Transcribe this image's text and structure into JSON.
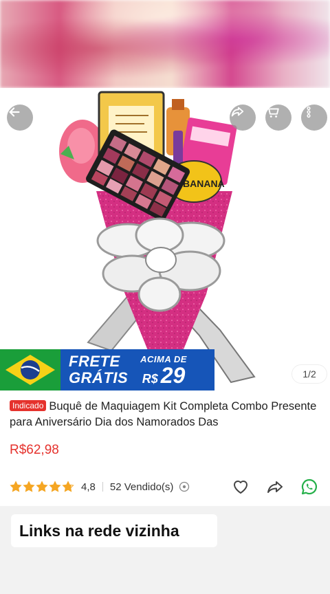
{
  "nav": {
    "back_icon": "arrow-left-icon",
    "share_icon": "share-icon",
    "cart_icon": "cart-icon",
    "more_icon": "more-vertical-icon"
  },
  "banner": {
    "frete_line1": "FRETE",
    "frete_line2": "GRÁTIS",
    "acima_label": "ACIMA DE",
    "currency": "R$",
    "threshold": "29",
    "colors": {
      "flag_green": "#1a9e3a",
      "flag_yellow": "#f7d117",
      "flag_blue": "#1d3f8f",
      "banner_blue": "#1655b8"
    }
  },
  "gallery": {
    "indicator": "1/2"
  },
  "product": {
    "badge": "Indicado",
    "title": "Buquê de Maquiagem Kit Completa Combo Presente para Aniversário Dia dos Namorados Das",
    "price": "R$62,98",
    "rating": "4,8",
    "sold": "52 Vendido(s)",
    "accent_color": "#e5322d",
    "star_color": "#f5a623",
    "star_count": 4.8
  },
  "actions": {
    "favorite_icon": "heart-icon",
    "share_icon": "share-icon",
    "whatsapp_icon": "whatsapp-icon"
  },
  "footer": {
    "links_label": "Links na rede vizinha"
  }
}
